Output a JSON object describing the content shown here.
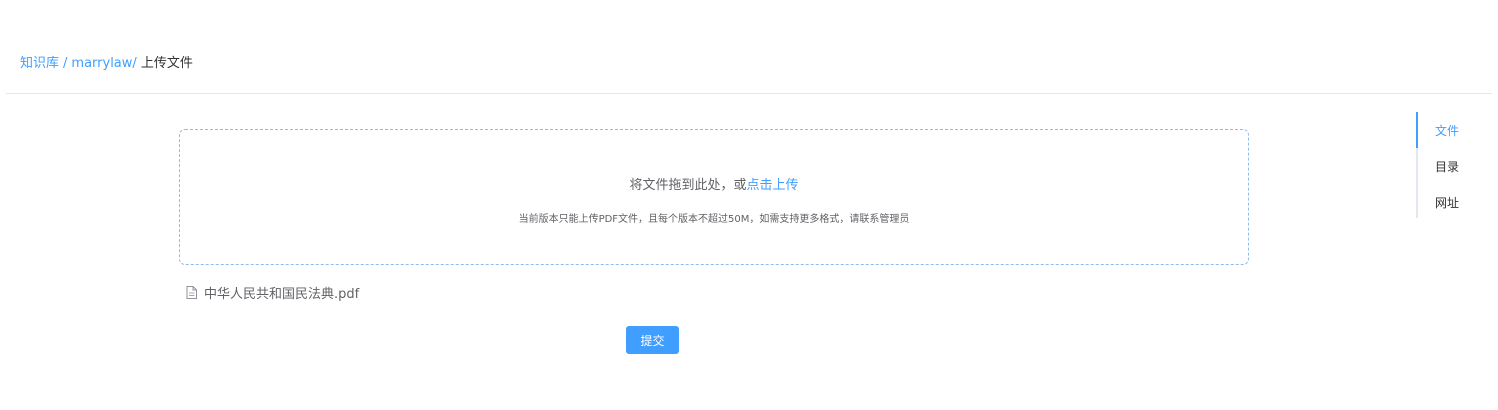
{
  "breadcrumb": {
    "items": [
      {
        "label": "知识库"
      },
      {
        "label": "marrylaw/"
      }
    ],
    "separator": "/",
    "current": "上传文件"
  },
  "upload": {
    "prompt": "将文件拖到此处，或",
    "click_label": "点击上传",
    "tip": "当前版本只能上传PDF文件，且每个版本不超过50M，如需支持更多格式，请联系管理员"
  },
  "file_list": [
    {
      "name": "中华人民共和国民法典.pdf",
      "icon": "document-icon"
    }
  ],
  "submit_label": "提交",
  "anchor_nav": {
    "items": [
      {
        "label": "文件",
        "active": true
      },
      {
        "label": "目录",
        "active": false
      },
      {
        "label": "网址",
        "active": false
      }
    ]
  },
  "colors": {
    "accent": "#409eff",
    "text": "#303133",
    "muted": "#606266",
    "border": "#e4e7ed"
  }
}
